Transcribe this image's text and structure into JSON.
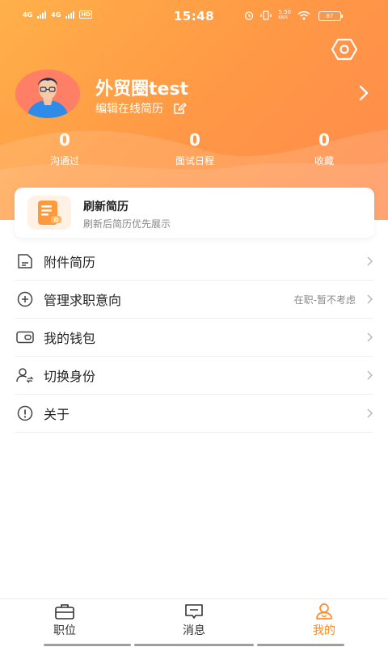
{
  "status_bar": {
    "time": "15:48",
    "network_1": "4G",
    "network_2": "4G",
    "hd_badge": "HD",
    "speed_value": "5.50",
    "speed_unit": "KB/S",
    "battery": "87"
  },
  "profile": {
    "name": "外贸圈test",
    "edit_resume": "编辑在线简历"
  },
  "stats": [
    {
      "value": "0",
      "label": "沟通过"
    },
    {
      "value": "0",
      "label": "面试日程"
    },
    {
      "value": "0",
      "label": "收藏"
    }
  ],
  "refresh_card": {
    "title": "刷新简历",
    "subtitle": "刷新后简历优先展示"
  },
  "menu": [
    {
      "label": "附件简历",
      "value": "",
      "icon": "document-icon"
    },
    {
      "label": "管理求职意向",
      "value": "在职-暂不考虑",
      "icon": "plus-circle-icon"
    },
    {
      "label": "我的钱包",
      "value": "",
      "icon": "wallet-icon"
    },
    {
      "label": "切换身份",
      "value": "",
      "icon": "switch-user-icon"
    },
    {
      "label": "关于",
      "value": "",
      "icon": "info-icon"
    }
  ],
  "tabbar": {
    "tabs": [
      {
        "label": "职位",
        "icon": "briefcase-icon"
      },
      {
        "label": "消息",
        "icon": "message-icon"
      },
      {
        "label": "我的",
        "icon": "person-icon"
      }
    ],
    "active_index": 2
  },
  "colors": {
    "accent": "#ff8a2a",
    "header_start": "#ffb04a",
    "header_end": "#ff8a4c"
  }
}
